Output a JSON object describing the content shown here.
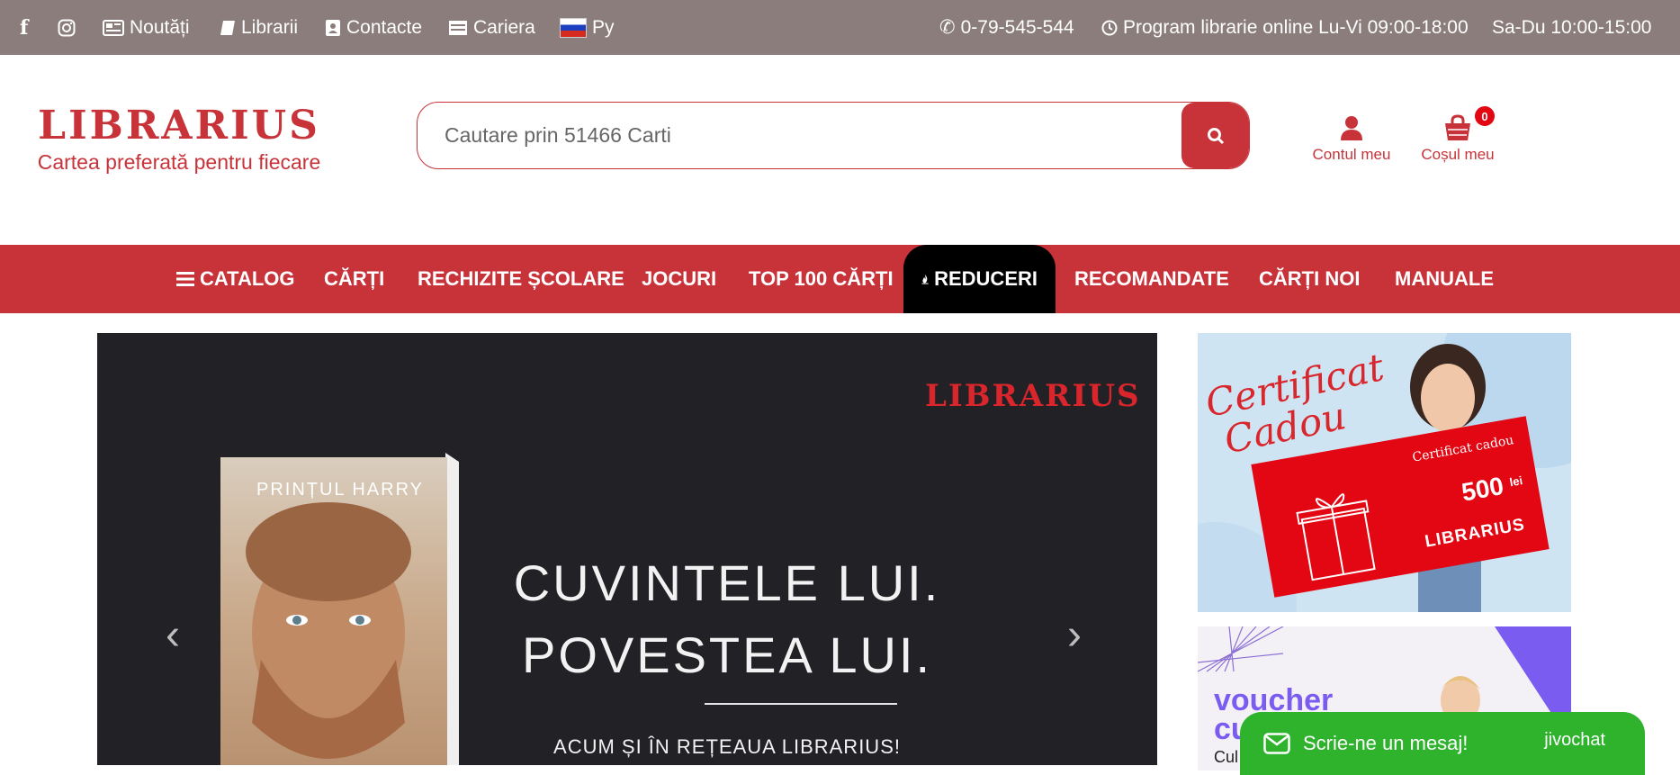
{
  "topbar": {
    "links": [
      {
        "label": "Noutăți",
        "icon": "newspaper-icon"
      },
      {
        "label": "Librarii",
        "icon": "book-icon"
      },
      {
        "label": "Contacte",
        "icon": "address-book-icon"
      },
      {
        "label": "Cariera",
        "icon": "career-icon"
      },
      {
        "label": "Ру",
        "icon": "flag-ru-icon"
      }
    ],
    "phone": "0-79-545-544",
    "schedule": "Program librarie online Lu-Vi 09:00-18:00",
    "schedule_weekend": "Sa-Du 10:00-15:00"
  },
  "header": {
    "logo": "LIBRARIUS",
    "tagline": "Cartea preferată pentru fiecare",
    "search_placeholder": "Cautare prin 51466 Carti",
    "account_label": "Contul meu",
    "cart_label": "Coșul meu",
    "cart_count": "0"
  },
  "nav": {
    "items": [
      "CATALOG",
      "CĂRȚI",
      "RECHIZITE ȘCOLARE",
      "JOCURI",
      "TOP 100 CĂRȚI",
      "REDUCERI",
      "RECOMANDATE",
      "CĂRȚI NOI",
      "MANUALE"
    ],
    "active": "REDUCERI"
  },
  "hero": {
    "logo": "LIBRARIUS",
    "book_author": "PRINȚUL HARRY",
    "headline_1": "CUVINTELE LUI.",
    "headline_2": "POVESTEA LUI.",
    "subline": "ACUM ȘI ÎN REȚEAUA LIBRARIUS!"
  },
  "gift_banner": {
    "title_1": "Certificat",
    "title_2": "Cadou",
    "card_title": "Certificat cadou",
    "amount": "500",
    "currency": "lei",
    "card_brand": "LIBRARIUS"
  },
  "voucher_banner": {
    "title_1": "voucher",
    "title_2": "cu",
    "fragment": "Cul"
  },
  "chat": {
    "label": "Scrie-ne un mesaj!",
    "brand": "jivochat"
  },
  "colors": {
    "brand_red": "#c8333a",
    "topbar_bg": "#8a7d7b",
    "hero_bg": "#222126",
    "chat_green": "#2fb32d"
  }
}
